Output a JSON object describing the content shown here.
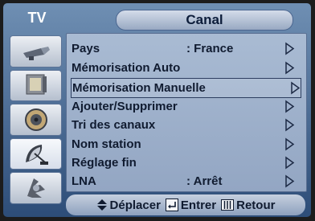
{
  "sidebar": {
    "tab_label": "TV",
    "icons": [
      "antenna-icon",
      "tv-set-icon",
      "speaker-icon",
      "satellite-dish-icon",
      "gear-icon"
    ],
    "active_index": 3
  },
  "menu": {
    "title": "Canal",
    "items": [
      {
        "label": "Pays",
        "value": ": France"
      },
      {
        "label": "Mémorisation Auto",
        "value": ""
      },
      {
        "label": "Mémorisation Manuelle",
        "value": ""
      },
      {
        "label": "Ajouter/Supprimer",
        "value": ""
      },
      {
        "label": "Tri des canaux",
        "value": ""
      },
      {
        "label": "Nom station",
        "value": ""
      },
      {
        "label": "Réglage fin",
        "value": ""
      },
      {
        "label": "LNA",
        "value": ": Arrêt"
      }
    ],
    "selected_index": 2
  },
  "footer": {
    "move_label": "Déplacer",
    "enter_label": "Entrer",
    "return_label": "Retour"
  }
}
